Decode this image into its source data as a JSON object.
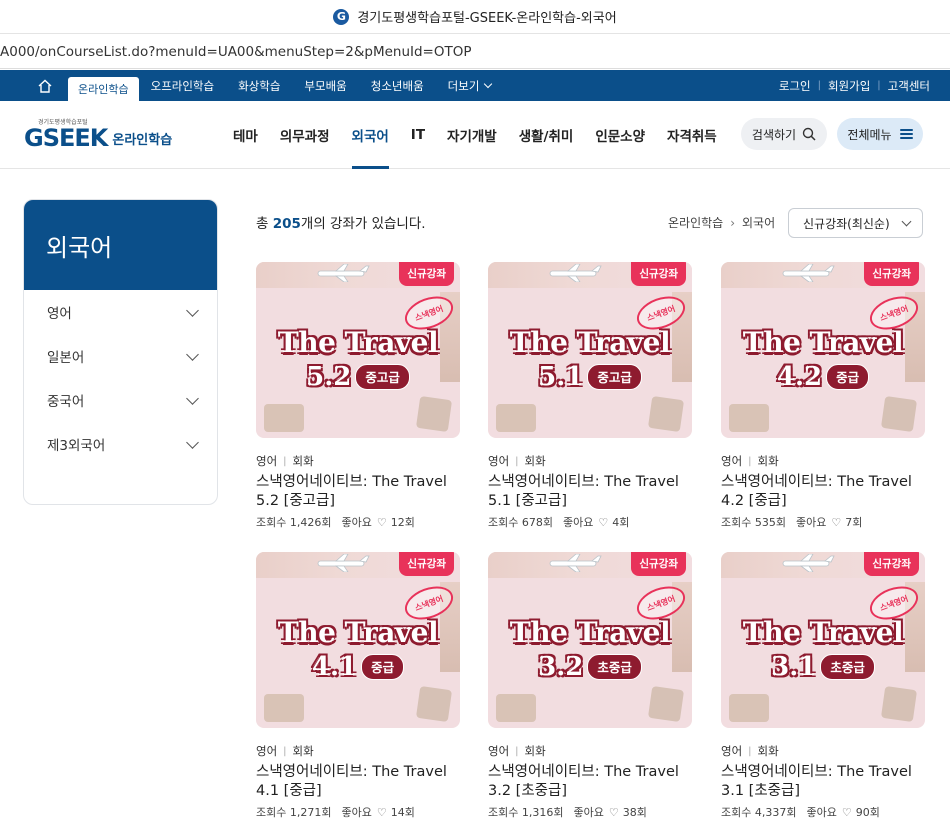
{
  "window": {
    "title": "경기도평생학습포털-GSEEK-온라인학습-외국어",
    "url": "A000/onCourseList.do?menuId=UA00&menuStep=2&pMenuId=OTOP"
  },
  "topnav": {
    "tabs": [
      "온라인학습",
      "오프라인학습",
      "화상학습",
      "부모배움",
      "청소년배움",
      "더보기"
    ],
    "right": [
      "로그인",
      "회원가입",
      "고객센터"
    ]
  },
  "header": {
    "logo_small": "경기도평생학습포털",
    "logo_text": "GSEEK",
    "logo_sub": "온라인학습",
    "menu": [
      "테마",
      "의무과정",
      "외국어",
      "IT",
      "자기개발",
      "생활/취미",
      "인문소양",
      "자격취득"
    ],
    "search_label": "검색하기",
    "allmenu_label": "전체메뉴"
  },
  "sidebar": {
    "title": "외국어",
    "items": [
      "영어",
      "일본어",
      "중국어",
      "제3외국어"
    ]
  },
  "content": {
    "count_prefix": "총 ",
    "count": "205",
    "count_suffix": "개의 강좌가 있습니다.",
    "breadcrumb": [
      "온라인학습",
      "외국어"
    ],
    "sort_label": "신규강좌(최신순)"
  },
  "colors": {
    "brand": "#0b4f8a",
    "tag": "#e8325a",
    "thumb_bg": "#f2dde0"
  },
  "courses": [
    {
      "tag": "신규강좌",
      "thumb_title": "The Travel",
      "thumb_num": "5.2",
      "thumb_level": "중고급",
      "category": "영어",
      "subcategory": "회화",
      "title": "스낵영어네이티브: The Travel 5.2 [중고급]",
      "views": "조회수 1,426회",
      "likes_label": "좋아요",
      "likes": "12회"
    },
    {
      "tag": "신규강좌",
      "thumb_title": "The Travel",
      "thumb_num": "5.1",
      "thumb_level": "중고급",
      "category": "영어",
      "subcategory": "회화",
      "title": "스낵영어네이티브: The Travel 5.1 [중고급]",
      "views": "조회수 678회",
      "likes_label": "좋아요",
      "likes": "4회"
    },
    {
      "tag": "신규강좌",
      "thumb_title": "The Travel",
      "thumb_num": "4.2",
      "thumb_level": "중급",
      "category": "영어",
      "subcategory": "회화",
      "title": "스낵영어네이티브: The Travel 4.2 [중급]",
      "views": "조회수 535회",
      "likes_label": "좋아요",
      "likes": "7회"
    },
    {
      "tag": "신규강좌",
      "thumb_title": "The Travel",
      "thumb_num": "4.1",
      "thumb_level": "중급",
      "category": "영어",
      "subcategory": "회화",
      "title": "스낵영어네이티브: The Travel 4.1 [중급]",
      "views": "조회수 1,271회",
      "likes_label": "좋아요",
      "likes": "14회"
    },
    {
      "tag": "신규강좌",
      "thumb_title": "The Travel",
      "thumb_num": "3.2",
      "thumb_level": "초중급",
      "category": "영어",
      "subcategory": "회화",
      "title": "스낵영어네이티브: The Travel 3.2 [초중급]",
      "views": "조회수 1,316회",
      "likes_label": "좋아요",
      "likes": "38회"
    },
    {
      "tag": "신규강좌",
      "thumb_title": "The Travel",
      "thumb_num": "3.1",
      "thumb_level": "초중급",
      "category": "영어",
      "subcategory": "회화",
      "title": "스낵영어네이티브: The Travel 3.1 [초중급]",
      "views": "조회수 4,337회",
      "likes_label": "좋아요",
      "likes": "90회"
    }
  ]
}
